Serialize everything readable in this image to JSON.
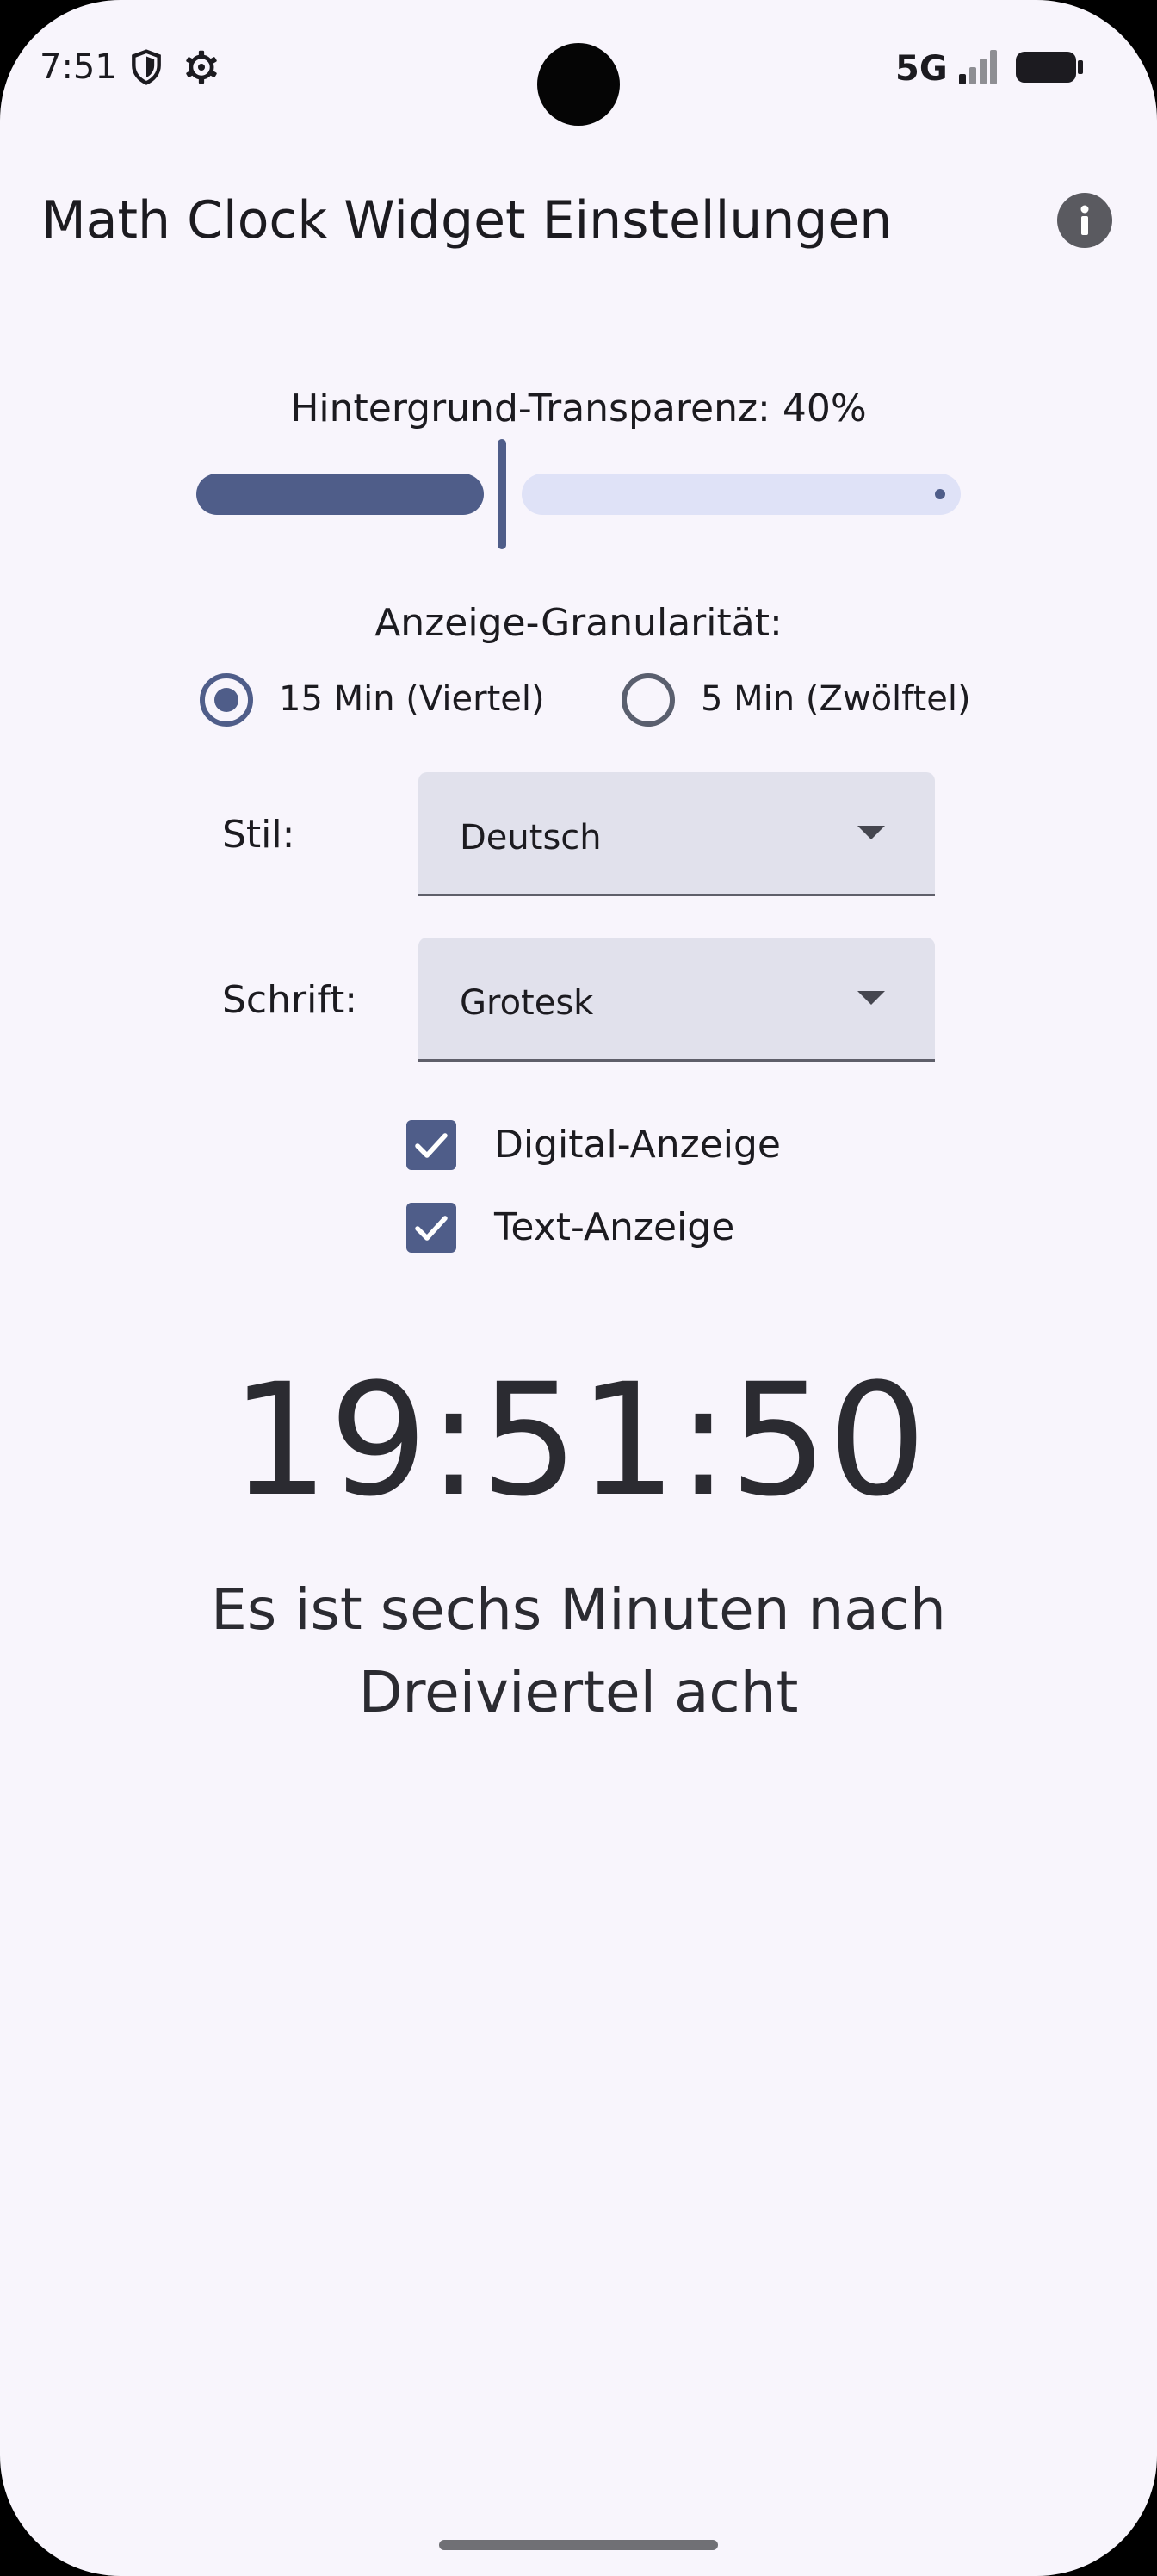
{
  "status_bar": {
    "time": "7:51",
    "network": "5G",
    "icons": [
      "shield-icon",
      "gear-icon",
      "signal-icon",
      "battery-icon"
    ]
  },
  "app_bar": {
    "title": "Math Clock Widget Einstellungen",
    "info_icon": "info-icon"
  },
  "transparency": {
    "label": "Hintergrund-Transparenz: 40%",
    "value": 0.4
  },
  "granularity": {
    "label": "Anzeige-Granularität:",
    "options": [
      {
        "label": "15 Min (Viertel)",
        "selected": true
      },
      {
        "label": "5 Min (Zwölftel)",
        "selected": false
      }
    ]
  },
  "style": {
    "label": "Stil:",
    "value": "Deutsch"
  },
  "font": {
    "label": "Schrift:",
    "value": "Grotesk"
  },
  "toggles": [
    {
      "label": "Digital-Anzeige",
      "checked": true
    },
    {
      "label": "Text-Anzeige",
      "checked": true
    }
  ],
  "preview": {
    "digital_time": "19:51:50",
    "text_line1": "Es ist sechs Minuten nach",
    "text_line2": "Dreiviertel acht"
  },
  "colors": {
    "accent": "#4f5d89",
    "background": "#f8f5fc",
    "track_inactive": "#dfe2f7",
    "dropdown_fill": "#e1e1ec"
  }
}
